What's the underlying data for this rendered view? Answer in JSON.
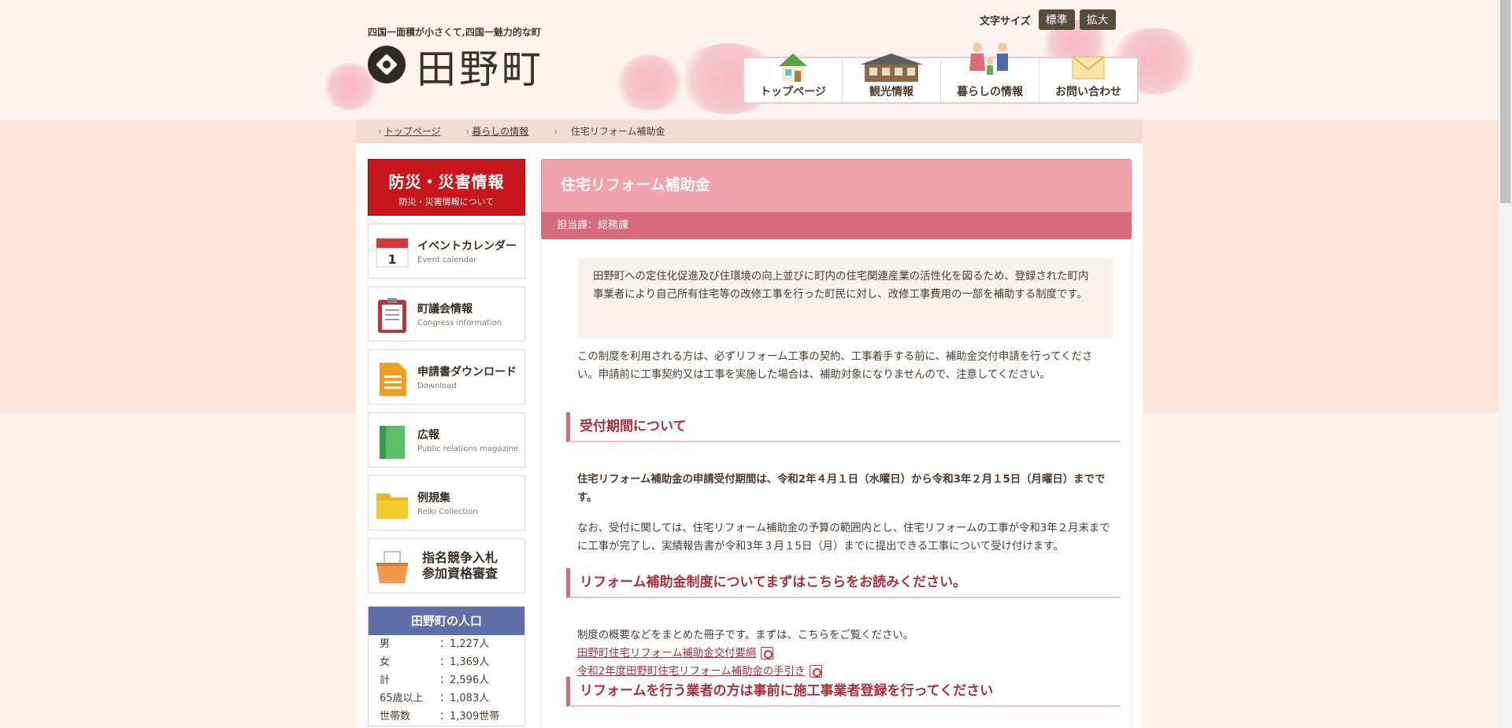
{
  "header": {
    "tagline": "四国一面積が小さくて,四国一魅力的な町",
    "site_name": "田野町",
    "fontsize_label": "文字サイズ",
    "fontsize_normal": "標準",
    "fontsize_large": "拡大"
  },
  "gnav": [
    {
      "label": "トップページ",
      "icon": "house-icon"
    },
    {
      "label": "観光情報",
      "icon": "old-building-icon"
    },
    {
      "label": "暮らしの情報",
      "icon": "family-icon"
    },
    {
      "label": "お問い合わせ",
      "icon": "envelope-icon"
    }
  ],
  "breadcrumb": [
    "トップページ",
    "暮らしの情報",
    "住宅リフォーム補助金"
  ],
  "sidebar": {
    "disaster_title": "防災・災害情報",
    "disaster_sub": "防災・災害情報について",
    "items": [
      {
        "jp": "イベントカレンダー",
        "en": "Event calendar"
      },
      {
        "jp": "町議会情報",
        "en": "Congress information"
      },
      {
        "jp": "申請書ダウンロード",
        "en": "Download"
      },
      {
        "jp": "広報",
        "en": "Public relations magazine"
      },
      {
        "jp": "例規集",
        "en": "Reiki Collection"
      }
    ],
    "bid_line1": "指名競争入札",
    "bid_line2": "参加資格審査",
    "population_title": "田野町の人口",
    "population": [
      {
        "k": "男",
        "v": "：1,227人"
      },
      {
        "k": "女",
        "v": "：1,369人"
      },
      {
        "k": "計",
        "v": "：2,596人"
      },
      {
        "k": "65歳以上",
        "v": "：1,083人"
      },
      {
        "k": "世帯数",
        "v": "：1,309世帯"
      }
    ]
  },
  "main": {
    "title": "住宅リフォーム補助金",
    "dept": "担当課：総務課",
    "lead": "田野町への定住化促進及び住環境の向上並びに町内の住宅関連産業の活性化を図るため、登録された町内事業者により自己所有住宅等の改修工事を行った町民に対し、改修工事費用の一部を補助する制度です。",
    "para1": "この制度を利用される方は、必ずリフォーム工事の契約、工事着手する前に、補助金交付申請を行ってください。申請前に工事契約又は工事を実施した場合は、補助対象になりませんので、注意してください。",
    "h_period": "受付期間について",
    "period_bold": "住宅リフォーム補助金の申請受付期間は、令和2年４月１日（水曜日）から令和3年２月１5日（月曜日）までです。",
    "period_note": "なお、受付に関しては、住宅リフォーム補助金の予算の範囲内とし、住宅リフォームの工事が令和3年２月末までに工事が完了し、実績報告書が令和3年３月１5日（月）までに提出できる工事について受け付けます。",
    "h_first": "リフォーム補助金制度についてまずはこちらをお読みください。",
    "first_text": "制度の概要などをまとめた冊子です。まずは、こちらをご覧ください。",
    "link1": "田野町住宅リフォーム補助金交付要綱",
    "link2": "令和2年度田野町住宅リフォーム補助金の手引き",
    "h_contractor": "リフォームを行う業者の方は事前に施工事業者登録を行ってください"
  }
}
